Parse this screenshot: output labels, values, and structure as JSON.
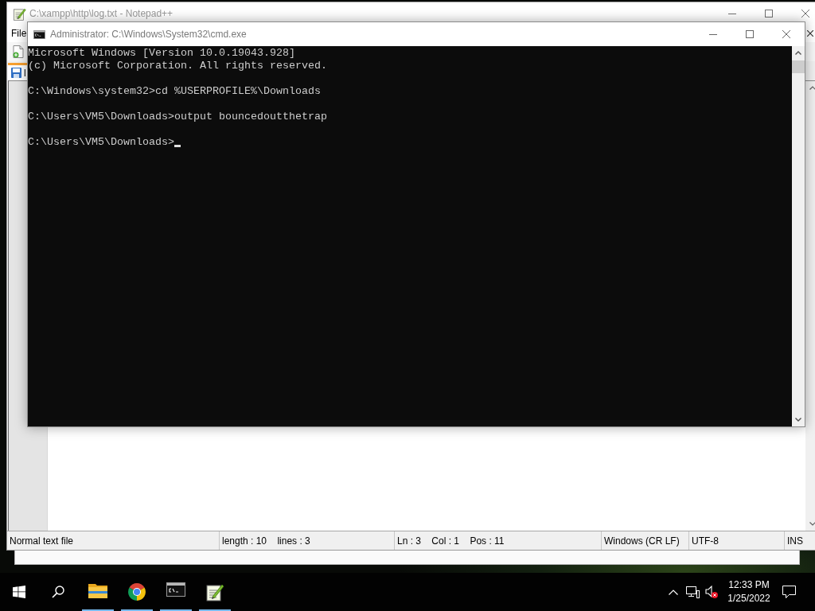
{
  "notepad_window": {
    "title": "C:\\xampp\\http\\log.txt - Notepad++",
    "menu": [
      "File"
    ],
    "tab": {
      "label": "l",
      "selected": true
    },
    "status_bar": [
      "Normal text file",
      "length : 10    lines : 3",
      "Ln : 3    Col : 1    Pos : 11",
      "Windows (CR LF)",
      "UTF-8",
      "INS"
    ]
  },
  "cmd_window": {
    "title": "Administrator: C:\\Windows\\System32\\cmd.exe",
    "console": {
      "blocks": [
        [
          "Microsoft Windows [Version 10.0.19043.928]",
          "(c) Microsoft Corporation. All rights reserved."
        ],
        [
          "C:\\Windows\\system32>cd %USERPROFILE%\\Downloads"
        ],
        [
          "C:\\Users\\VM5\\Downloads>output bouncedoutthetrap"
        ],
        [
          "C:\\Users\\VM5\\Downloads>"
        ]
      ],
      "cursor": true
    }
  },
  "taskbar": {
    "apps": [
      {
        "kind": "folder",
        "running": true
      },
      {
        "kind": "browser",
        "running": true
      },
      {
        "kind": "terminal",
        "running": true
      },
      {
        "kind": "notepad",
        "running": true
      }
    ],
    "tray": {
      "volume_muted": true,
      "time": "12:33 PM",
      "date": "1/25/2022"
    }
  }
}
